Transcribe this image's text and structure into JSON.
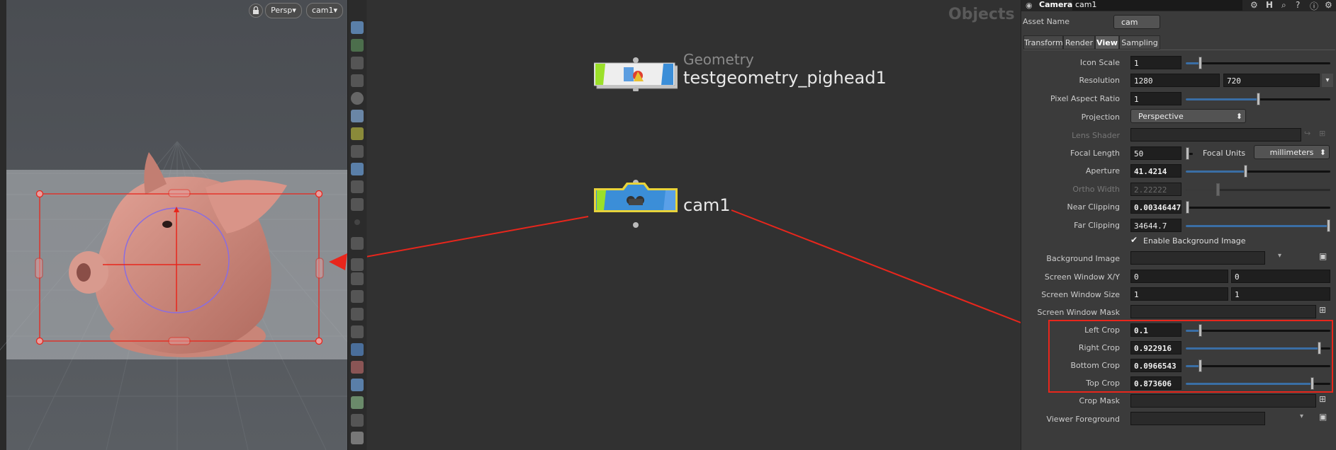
{
  "viewport": {
    "persp_label": "Persp",
    "cam_label": "cam1",
    "lock_icon": "lock-icon",
    "dropdown_caret": "▾"
  },
  "network": {
    "context_title": "Objects",
    "geometry_node": {
      "type_label": "Geometry",
      "name": "testgeometry_pighead1"
    },
    "camera_node": {
      "name": "cam1"
    }
  },
  "params": {
    "header_type": "Camera",
    "header_name": "cam1",
    "asset_name_label": "Asset Name",
    "asset_name_value": "cam",
    "tabs": [
      "Transform",
      "Render",
      "View",
      "Sampling"
    ],
    "active_tab": "View",
    "rows": {
      "icon_scale": {
        "label": "Icon Scale",
        "value": "1"
      },
      "resolution": {
        "label": "Resolution",
        "x": "1280",
        "y": "720"
      },
      "pixel_aspect": {
        "label": "Pixel Aspect Ratio",
        "value": "1"
      },
      "projection": {
        "label": "Projection",
        "value": "Perspective"
      },
      "lens_shader": {
        "label": "Lens Shader",
        "value": ""
      },
      "focal_length": {
        "label": "Focal Length",
        "value": "50",
        "units_label": "Focal Units",
        "units_value": "millimeters"
      },
      "aperture": {
        "label": "Aperture",
        "value": "41.4214"
      },
      "ortho_width": {
        "label": "Ortho Width",
        "value": "2.22222"
      },
      "near_clipping": {
        "label": "Near Clipping",
        "value": "0.00346447"
      },
      "far_clipping": {
        "label": "Far Clipping",
        "value": "34644.7"
      },
      "enable_bg": {
        "label": "Enable Background Image",
        "checked": true
      },
      "bg_image": {
        "label": "Background Image",
        "value": ""
      },
      "screen_window_xy": {
        "label": "Screen Window X/Y",
        "x": "0",
        "y": "0"
      },
      "screen_window_size": {
        "label": "Screen Window Size",
        "x": "1",
        "y": "1"
      },
      "screen_window_mask": {
        "label": "Screen Window Mask",
        "value": ""
      },
      "left_crop": {
        "label": "Left Crop",
        "value": "0.1"
      },
      "right_crop": {
        "label": "Right Crop",
        "value": "0.922916"
      },
      "bottom_crop": {
        "label": "Bottom Crop",
        "value": "0.0966543"
      },
      "top_crop": {
        "label": "Top Crop",
        "value": "0.873606"
      },
      "crop_mask": {
        "label": "Crop Mask",
        "value": ""
      },
      "viewer_foreground": {
        "label": "Viewer Foreground",
        "value": ""
      }
    },
    "slider_levels": {
      "icon_scale": 0.1,
      "pixel_aspect": 0.5,
      "focal_length": 0.05,
      "aperture": 0.41,
      "ortho_width": 0.22,
      "near_clipping": 0.0,
      "far_clipping": 1.0,
      "left_crop": 0.1,
      "right_crop": 0.923,
      "bottom_crop": 0.097,
      "top_crop": 0.874
    }
  },
  "colors": {
    "annotation_red": "#e8261c",
    "camera_node_blue": "#3b8ed8",
    "node_green": "#9be02a",
    "selection_yellow": "#e8d33a"
  }
}
